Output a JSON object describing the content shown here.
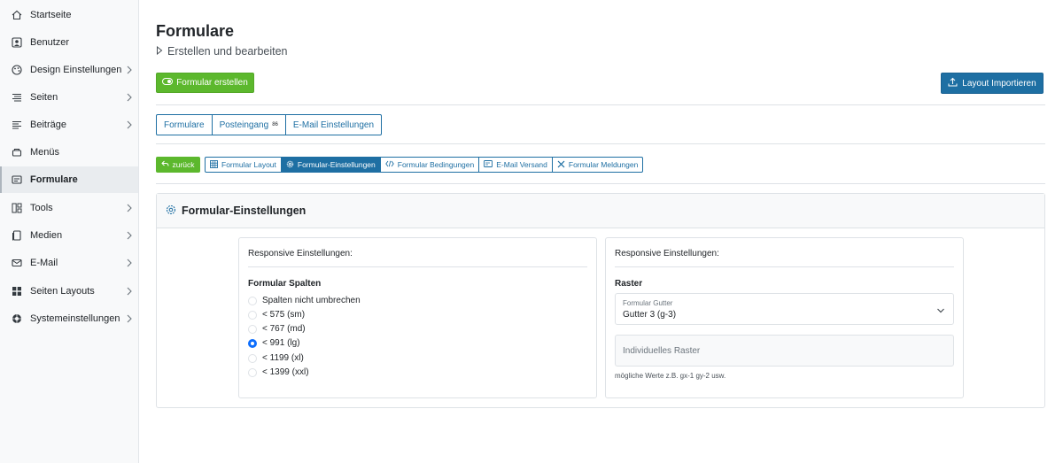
{
  "sidebar": {
    "items": [
      {
        "label": "Startseite",
        "icon": "home-icon",
        "has_children": false,
        "active": false
      },
      {
        "label": "Benutzer",
        "icon": "user-icon",
        "has_children": false,
        "active": false
      },
      {
        "label": "Design Einstellungen",
        "icon": "palette-icon",
        "has_children": true,
        "active": false
      },
      {
        "label": "Seiten",
        "icon": "pages-icon",
        "has_children": true,
        "active": false
      },
      {
        "label": "Beiträge",
        "icon": "posts-icon",
        "has_children": true,
        "active": false
      },
      {
        "label": "Menüs",
        "icon": "menu-icon",
        "has_children": false,
        "active": false
      },
      {
        "label": "Formulare",
        "icon": "form-icon",
        "has_children": false,
        "active": true
      },
      {
        "label": "Tools",
        "icon": "tools-icon",
        "has_children": true,
        "active": false
      },
      {
        "label": "Medien",
        "icon": "media-icon",
        "has_children": true,
        "active": false
      },
      {
        "label": "E-Mail",
        "icon": "mail-icon",
        "has_children": true,
        "active": false
      },
      {
        "label": "Seiten Layouts",
        "icon": "layouts-icon",
        "has_children": true,
        "active": false
      },
      {
        "label": "Systemeinstellungen",
        "icon": "system-settings-icon",
        "has_children": true,
        "active": false
      }
    ]
  },
  "header": {
    "title": "Formulare",
    "subtitle": "Erstellen und bearbeiten"
  },
  "toolbar": {
    "create_label": "Formular erstellen",
    "import_label": "Layout Importieren"
  },
  "main_tabs": [
    {
      "label": "Formulare",
      "badge": ""
    },
    {
      "label": "Posteingang",
      "badge": "86"
    },
    {
      "label": "E-Mail Einstellungen",
      "badge": ""
    }
  ],
  "sub_nav": {
    "back_label": "zurück",
    "tabs": [
      {
        "label": "Formular Layout",
        "icon": "grid-icon",
        "active": false
      },
      {
        "label": "Formular-Einstellungen",
        "icon": "gear-icon",
        "active": true
      },
      {
        "label": "Formular Bedingungen",
        "icon": "code-icon",
        "active": false
      },
      {
        "label": "E-Mail Versand",
        "icon": "mail-send-icon",
        "active": false
      },
      {
        "label": "Formular Meldungen",
        "icon": "tools-cross-icon",
        "active": false
      }
    ]
  },
  "card": {
    "title": "Formular-Einstellungen",
    "left_panel": {
      "title": "Responsive Einstellungen:",
      "label": "Formular Spalten",
      "options": [
        "Spalten nicht umbrechen",
        "< 575 (sm)",
        "< 767 (md)",
        "< 991 (lg)",
        "< 1199 (xl)",
        "< 1399 (xxl)"
      ],
      "selected": "< 991 (lg)"
    },
    "right_panel": {
      "title": "Responsive Einstellungen:",
      "label": "Raster",
      "select_label": "Formular Gutter",
      "select_value": "Gutter 3 (g-3)",
      "input_placeholder": "Individuelles Raster",
      "help_text": "mögliche Werte z.B. gx-1 gy-2 usw."
    }
  },
  "colors": {
    "green": "#5cb82d",
    "blue": "#1e6fa3",
    "radio_checked": "#0d6efd"
  }
}
